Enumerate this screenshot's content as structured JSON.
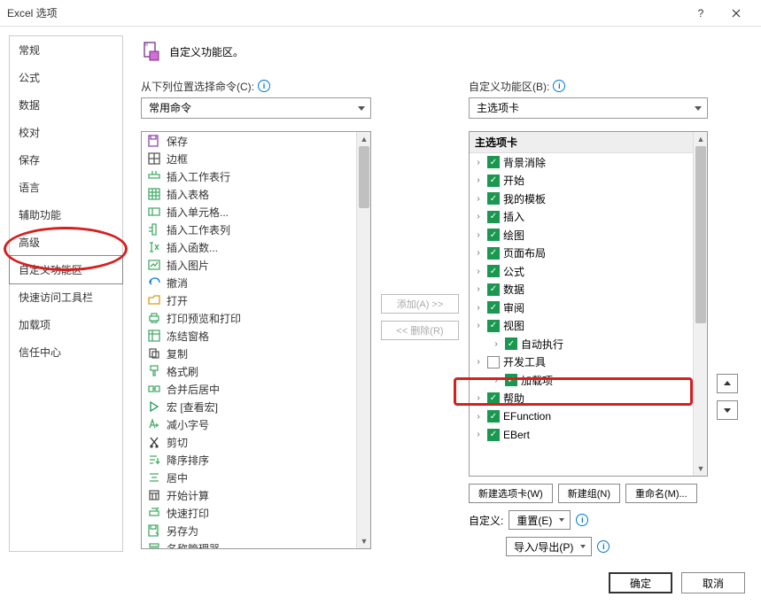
{
  "window": {
    "title": "Excel 选项"
  },
  "sidebar": {
    "items": [
      {
        "label": "常规"
      },
      {
        "label": "公式"
      },
      {
        "label": "数据"
      },
      {
        "label": "校对"
      },
      {
        "label": "保存"
      },
      {
        "label": "语言"
      },
      {
        "label": "辅助功能"
      },
      {
        "label": "高级"
      },
      {
        "label": "自定义功能区",
        "selected": true
      },
      {
        "label": "快速访问工具栏"
      },
      {
        "label": "加载项"
      },
      {
        "label": "信任中心"
      }
    ]
  },
  "header": {
    "title": "自定义功能区。"
  },
  "left": {
    "label": "从下列位置选择命令(C):",
    "dropdown": "常用命令",
    "commands": [
      {
        "icon": "save",
        "label": "保存"
      },
      {
        "icon": "border",
        "label": "边框",
        "expand": true
      },
      {
        "icon": "insert-row",
        "label": "插入工作表行"
      },
      {
        "icon": "insert-table",
        "label": "插入表格"
      },
      {
        "icon": "insert-cells",
        "label": "插入单元格..."
      },
      {
        "icon": "insert-col",
        "label": "插入工作表列"
      },
      {
        "icon": "insert-fx",
        "label": "插入函数..."
      },
      {
        "icon": "insert-pic",
        "label": "插入图片"
      },
      {
        "icon": "undo",
        "label": "撤消",
        "expand": true
      },
      {
        "icon": "open",
        "label": "打开"
      },
      {
        "icon": "print-prev",
        "label": "打印预览和打印"
      },
      {
        "icon": "freeze",
        "label": "冻结窗格",
        "expand": true
      },
      {
        "icon": "copy",
        "label": "复制"
      },
      {
        "icon": "format-painter",
        "label": "格式刷"
      },
      {
        "icon": "merge",
        "label": "合并后居中"
      },
      {
        "icon": "macro",
        "label": "宏 [查看宏]"
      },
      {
        "icon": "font-dec",
        "label": "减小字号"
      },
      {
        "icon": "cut",
        "label": "剪切"
      },
      {
        "icon": "sort-desc",
        "label": "降序排序"
      },
      {
        "icon": "center",
        "label": "居中"
      },
      {
        "icon": "calc",
        "label": "开始计算"
      },
      {
        "icon": "quickprint",
        "label": "快速打印"
      },
      {
        "icon": "saveas",
        "label": "另存为"
      },
      {
        "icon": "name-mgr",
        "label": "名称管理器"
      }
    ]
  },
  "middle": {
    "add": "添加(A) >>",
    "remove": "<< 删除(R)"
  },
  "right": {
    "label": "自定义功能区(B):",
    "dropdown": "主选项卡",
    "header": "主选项卡",
    "tabs": [
      {
        "label": "背景消除",
        "checked": true
      },
      {
        "label": "开始",
        "checked": true
      },
      {
        "label": "我的模板",
        "checked": true
      },
      {
        "label": "插入",
        "checked": true
      },
      {
        "label": "绘图",
        "checked": true
      },
      {
        "label": "页面布局",
        "checked": true
      },
      {
        "label": "公式",
        "checked": true
      },
      {
        "label": "数据",
        "checked": true
      },
      {
        "label": "审阅",
        "checked": true
      },
      {
        "label": "视图",
        "checked": true
      },
      {
        "label": "自动执行",
        "checked": true,
        "indent": true
      },
      {
        "label": "开发工具",
        "checked": false
      },
      {
        "label": "加载项",
        "checked": true,
        "indent": true
      },
      {
        "label": "帮助",
        "checked": true
      },
      {
        "label": "EFunction",
        "checked": true
      },
      {
        "label": "EBert",
        "checked": true
      }
    ],
    "buttons": {
      "newtab": "新建选项卡(W)",
      "newgroup": "新建组(N)",
      "rename": "重命名(M)..."
    },
    "custom_label": "自定义:",
    "reset": "重置(E)",
    "importexport": "导入/导出(P)"
  },
  "footer": {
    "ok": "确定",
    "cancel": "取消"
  }
}
